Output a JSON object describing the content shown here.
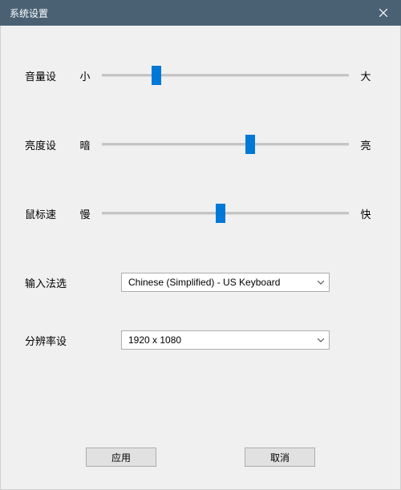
{
  "title": "系统设置",
  "sliders": [
    {
      "label": "音量设",
      "min_label": "小",
      "max_label": "大",
      "value": 22
    },
    {
      "label": "亮度设",
      "min_label": "暗",
      "max_label": "亮",
      "value": 60
    },
    {
      "label": "鼠标速",
      "min_label": "慢",
      "max_label": "快",
      "value": 48
    }
  ],
  "ime": {
    "label": "输入法选",
    "selected": "Chinese (Simplified) - US Keyboard"
  },
  "resolution": {
    "label": "分辨率设",
    "selected": "1920 x 1080"
  },
  "buttons": {
    "apply": "应用",
    "cancel": "取消"
  }
}
